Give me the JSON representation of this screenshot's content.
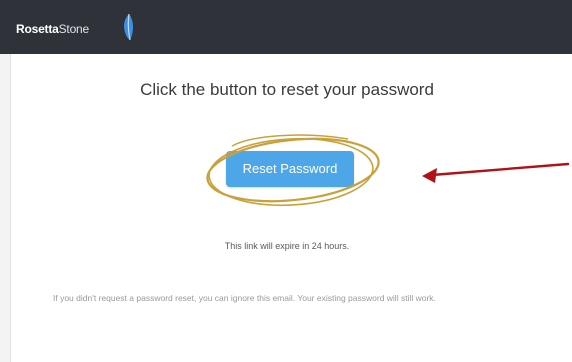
{
  "header": {
    "brand_bold": "Rosetta",
    "brand_light": "Stone",
    "logo_icon": "rosetta-stone-logo-icon",
    "bar_color": "#2f3339"
  },
  "email": {
    "headline": "Click the button to reset your password",
    "reset_button_label": "Reset Password",
    "button_color": "#4da6e8",
    "expiry_note": "This link will expire in 24 hours.",
    "ignore_note": "If you didn't request a password reset, you can ignore this email. Your existing password will still work."
  },
  "annotations": {
    "highlight_color": "#c9a13b",
    "arrow_color": "#b01217",
    "highlight_icon": "ellipse-highlight-icon",
    "arrow_icon": "arrow-left-icon"
  }
}
